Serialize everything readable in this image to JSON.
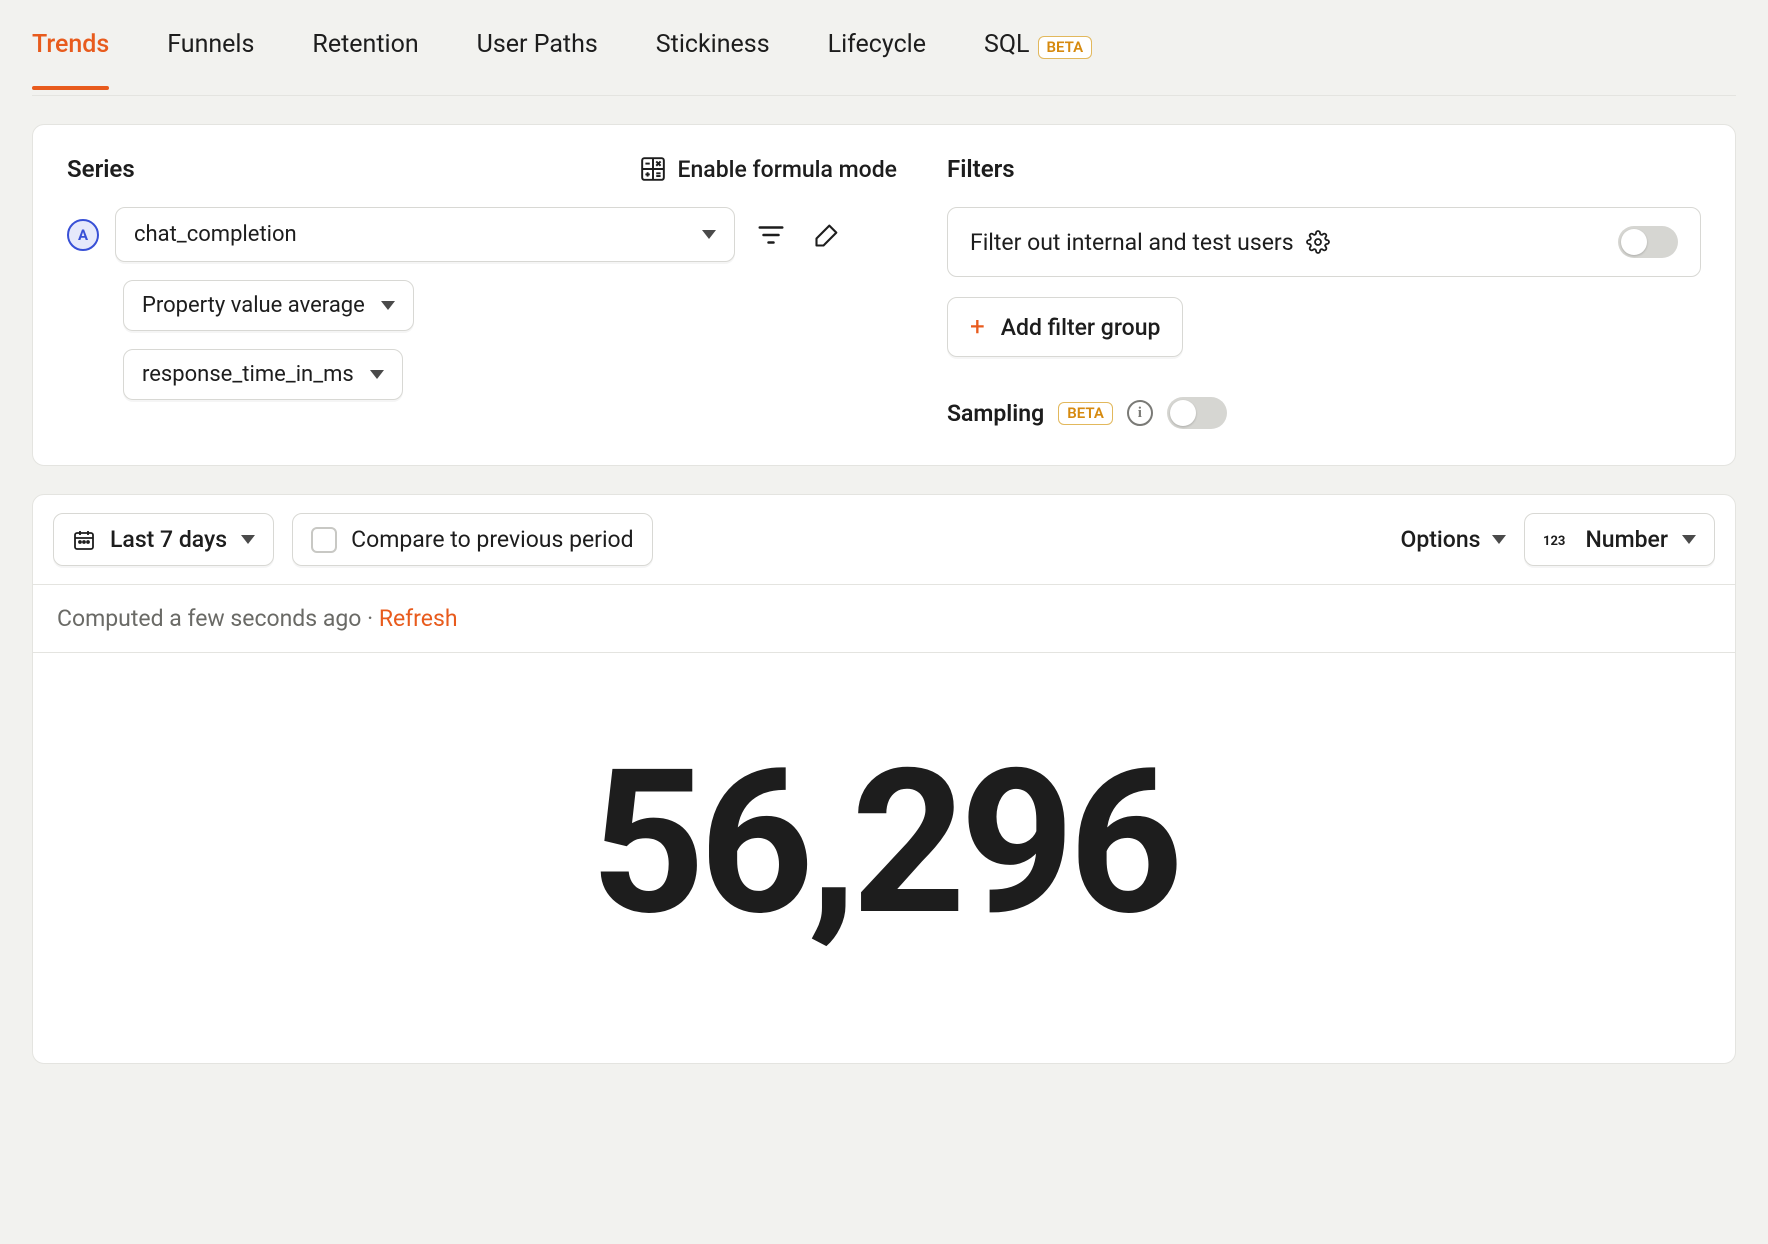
{
  "tabs": {
    "trends": "Trends",
    "funnels": "Funnels",
    "retention": "Retention",
    "user_paths": "User Paths",
    "stickiness": "Stickiness",
    "lifecycle": "Lifecycle",
    "sql": "SQL",
    "beta_badge": "BETA"
  },
  "series": {
    "title": "Series",
    "formula_btn": "Enable formula mode",
    "badge": "A",
    "event": "chat_completion",
    "aggregation": "Property value average",
    "property": "response_time_in_ms"
  },
  "filters": {
    "title": "Filters",
    "internal_users": "Filter out internal and test users",
    "add_group": "Add filter group",
    "sampling_label": "Sampling",
    "sampling_badge": "BETA"
  },
  "toolbar": {
    "date_range": "Last 7 days",
    "compare": "Compare to previous period",
    "options": "Options",
    "chart_type": "Number"
  },
  "status": {
    "computed": "Computed a few seconds ago",
    "sep": " · ",
    "refresh": "Refresh"
  },
  "result": {
    "value": "56,296"
  }
}
